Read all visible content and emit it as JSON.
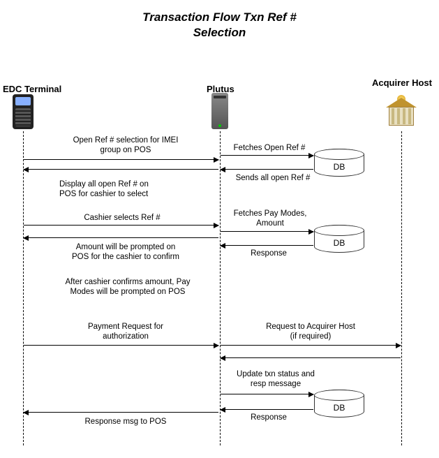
{
  "title_line1": "Transaction Flow Txn Ref #",
  "title_line2": "Selection",
  "lanes": {
    "edc": "EDC Terminal",
    "plutus": "Plutus",
    "acquirer": "Acquirer Host"
  },
  "db_label": "DB",
  "messages": {
    "m1": "Open Ref # selection for IMEI\ngroup on POS",
    "m2": "Fetches Open Ref #",
    "m3": "Sends all open Ref #",
    "m4": "Display all open Ref # on\nPOS for cashier to select",
    "m5": "Cashier selects Ref #",
    "m6": "Fetches Pay Modes,\nAmount",
    "m7": "Response",
    "m8": "Amount will be prompted on\nPOS for the cashier to confirm",
    "m9": "After cashier confirms amount, Pay\nModes will be prompted on POS",
    "m10": "Payment Request for\nauthorization",
    "m11": "Request to Acquirer Host\n(if required)",
    "m12": "Update txn status and\nresp message",
    "m13": "Response",
    "m14": "Response msg to POS"
  },
  "chart_data": {
    "type": "sequence-diagram",
    "title": "Transaction Flow Txn Ref # Selection",
    "participants": [
      "EDC Terminal",
      "Plutus",
      "DB",
      "Acquirer Host"
    ],
    "interactions": [
      {
        "from": "EDC Terminal",
        "to": "Plutus",
        "label": "Open Ref # selection for IMEI group on POS"
      },
      {
        "from": "Plutus",
        "to": "DB",
        "label": "Fetches Open Ref #"
      },
      {
        "from": "DB",
        "to": "Plutus",
        "label": "Sends all open Ref #"
      },
      {
        "from": "Plutus",
        "to": "EDC Terminal",
        "label": "Display all open Ref # on POS for cashier to select"
      },
      {
        "from": "EDC Terminal",
        "to": "Plutus",
        "label": "Cashier selects Ref #"
      },
      {
        "from": "Plutus",
        "to": "DB",
        "label": "Fetches Pay Modes, Amount"
      },
      {
        "from": "DB",
        "to": "Plutus",
        "label": "Response"
      },
      {
        "from": "Plutus",
        "to": "EDC Terminal",
        "label": "Amount will be prompted on POS for the cashier to confirm"
      },
      {
        "note_over": "EDC Terminal",
        "label": "After cashier confirms amount, Pay Modes will be prompted on POS"
      },
      {
        "from": "EDC Terminal",
        "to": "Plutus",
        "label": "Payment Request for authorization"
      },
      {
        "from": "Plutus",
        "to": "Acquirer Host",
        "label": "Request to Acquirer Host (if required)"
      },
      {
        "from": "Acquirer Host",
        "to": "Plutus",
        "label": ""
      },
      {
        "from": "Plutus",
        "to": "DB",
        "label": "Update txn status and resp message"
      },
      {
        "from": "DB",
        "to": "Plutus",
        "label": "Response"
      },
      {
        "from": "Plutus",
        "to": "EDC Terminal",
        "label": "Response msg to POS"
      }
    ]
  }
}
